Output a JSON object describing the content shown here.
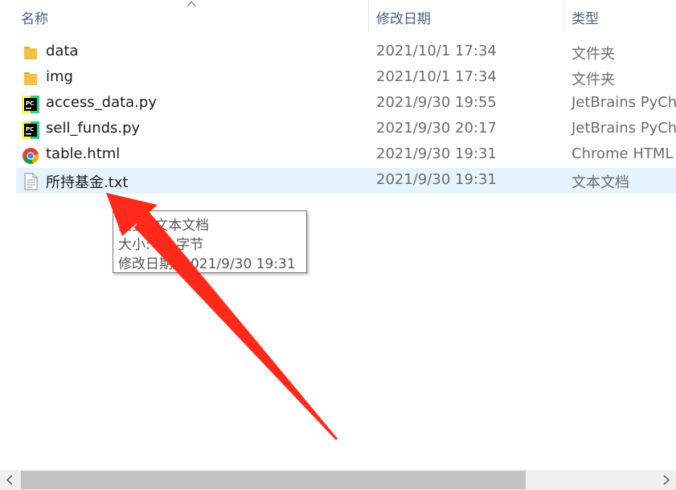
{
  "columns": {
    "name": "名称",
    "modified": "修改日期",
    "type": "类型"
  },
  "files": [
    {
      "name": "data",
      "modified": "2021/10/1 17:34",
      "type": "文件夹",
      "icon": "folder-icon"
    },
    {
      "name": "img",
      "modified": "2021/10/1 17:34",
      "type": "文件夹",
      "icon": "folder-icon"
    },
    {
      "name": "access_data.py",
      "modified": "2021/9/30 19:55",
      "type": "JetBrains PyCharm",
      "icon": "pycharm-icon"
    },
    {
      "name": "sell_funds.py",
      "modified": "2021/9/30 20:17",
      "type": "JetBrains PyCharm",
      "icon": "pycharm-icon"
    },
    {
      "name": "table.html",
      "modified": "2021/9/30 19:31",
      "type": "Chrome HTML",
      "icon": "chrome-icon"
    },
    {
      "name": "所持基金.txt",
      "modified": "2021/9/30 19:31",
      "type": "文本文档",
      "icon": "text-file-icon",
      "selected": true
    }
  ],
  "tooltip": {
    "type_line": "类型: 文本文档",
    "size_line": "大小: 72 字节",
    "modified_line": "修改日期: 2021/9/30 19:31"
  },
  "colors": {
    "selection": "#e5f3ff",
    "annotation_arrow": "#ff2a1a",
    "folder": "#f4c24a"
  }
}
